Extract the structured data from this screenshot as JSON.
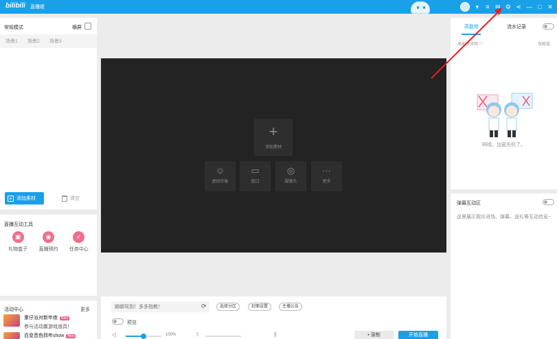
{
  "titlebar": {
    "logo": "bilibili",
    "app_name": "直播姬",
    "icons": [
      "avatar",
      "chevron-down-icon",
      "menu-icon",
      "mail-icon",
      "settings-icon",
      "share-icon",
      "minimize-icon",
      "maximize-icon",
      "close-icon"
    ],
    "glyphs": {
      "chevron": "▾",
      "menu": "≡",
      "mail": "✉",
      "settings": "⚙",
      "share": "⋖",
      "minimize": "—",
      "maximize": "□",
      "close": "✕"
    }
  },
  "scene_panel": {
    "mode_label": "常规模式",
    "orientation_label": "横屏",
    "scenes": [
      "场景1",
      "场景2",
      "场景3"
    ],
    "add_material_label": "添加素材",
    "clear_label": "清空"
  },
  "tools_panel": {
    "title": "直播互动工具",
    "tools": [
      {
        "label": "礼物盒子",
        "icon": "gift-icon",
        "glyph": "▣"
      },
      {
        "label": "直播预约",
        "icon": "reservation-icon",
        "glyph": "◉"
      },
      {
        "label": "任务中心",
        "icon": "task-icon",
        "glyph": "✓"
      }
    ]
  },
  "activity_panel": {
    "title": "活动中心",
    "more_label": "更多",
    "items": [
      {
        "title": "重仔派对新年夜",
        "badge": "New",
        "desc": "参与活动赢游戏道具！"
      },
      {
        "title": "百变音色拜年show",
        "badge": "New",
        "desc": ""
      }
    ]
  },
  "stage": {
    "add_material_label": "添加素材",
    "add_glyph": "+",
    "sources": [
      {
        "label": "虚拟形象",
        "icon": "virtual-avatar-icon",
        "glyph": "☺"
      },
      {
        "label": "窗口",
        "icon": "window-icon",
        "glyph": "▭"
      },
      {
        "label": "摄像头",
        "icon": "camera-icon",
        "glyph": "◎"
      },
      {
        "label": "更多",
        "icon": "more-icon",
        "glyph": "···"
      }
    ]
  },
  "right_panel": {
    "tabs": [
      "高能榜",
      "流水记录"
    ],
    "sub_left": "高能榜说明",
    "sub_right": "贡献值",
    "load_fail": "啊哦，加载失败了。",
    "danmaku_title": "弹幕互动区",
    "danmaku_desc": "这里展示观众进场、弹幕、送礼等互动信息~"
  },
  "bottom_bar": {
    "title_placeholder": "朝朝驾到！多多指教！",
    "refresh_glyph": "⟳",
    "chips": [
      "选择分区",
      "封面设置",
      "主播公告"
    ],
    "preview_label": "预览",
    "volume_value": "100%",
    "record_label": "录制",
    "record_glyph": "•",
    "start_live_label": "开始直播"
  },
  "colors": {
    "accent": "#1aa0e8",
    "pink": "#f25d8e",
    "stage": "#232323"
  }
}
